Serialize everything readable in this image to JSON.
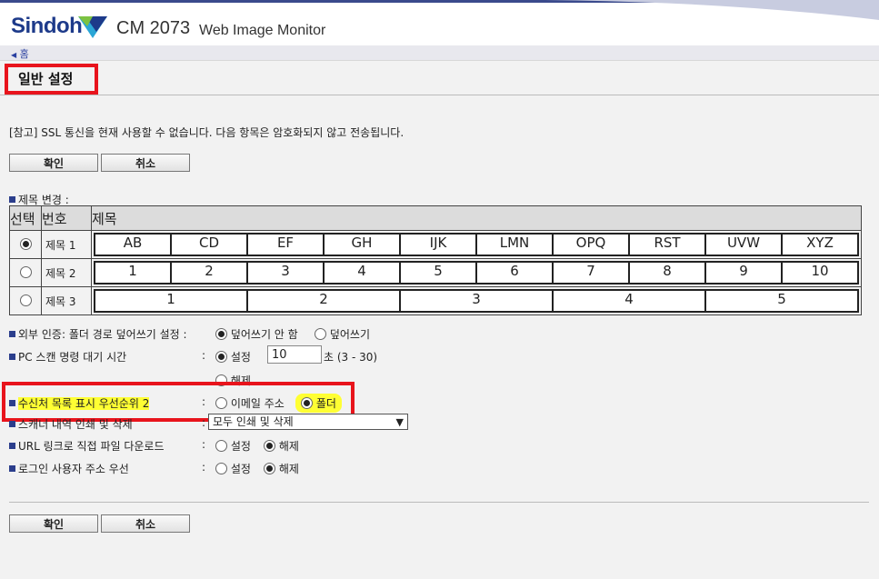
{
  "header": {
    "brand": "Sindoh",
    "model": "CM 2073",
    "product": "Web Image Monitor"
  },
  "nav": {
    "home_label": "홈"
  },
  "page": {
    "title": "일반 설정",
    "note": "[참고] SSL 통신을 현재 사용할 수 없습니다. 다음 항목은 암호화되지 않고 전송됩니다."
  },
  "buttons": {
    "ok": "확인",
    "cancel": "취소"
  },
  "title_change": {
    "label": "제목 변경 :",
    "headers": {
      "select": "선택",
      "number": "번호",
      "title": "제목"
    },
    "rows": [
      {
        "name": "제목 1",
        "selected": true,
        "cells": [
          "AB",
          "CD",
          "EF",
          "GH",
          "IJK",
          "LMN",
          "OPQ",
          "RST",
          "UVW",
          "XYZ"
        ]
      },
      {
        "name": "제목 2",
        "selected": false,
        "cells": [
          "1",
          "2",
          "3",
          "4",
          "5",
          "6",
          "7",
          "8",
          "9",
          "10"
        ]
      },
      {
        "name": "제목 3",
        "selected": false,
        "cells": [
          "1",
          "2",
          "3",
          "4",
          "5"
        ]
      }
    ]
  },
  "settings": {
    "external_auth": {
      "label": "외부 인증: 폴더 경로 덮어쓰기 설정 :",
      "opt1": "덮어쓰기 안 함",
      "opt2": "덮어쓰기",
      "selected": "opt1"
    },
    "pc_scan": {
      "label": "PC 스캔 명령 대기 시간",
      "opt_set": "설정",
      "value": "10",
      "unit_range": "초 (3 - 30)",
      "opt_release": "해제",
      "selected": "opt_set"
    },
    "dest_priority": {
      "label": "수신처 목록 표시 우선순위 2",
      "opt1": "이메일 주소",
      "opt2": "폴더",
      "selected": "opt2"
    },
    "scanner_history": {
      "label": "스캐너 내역 인쇄 및 삭제",
      "value": "모두 인쇄 및 삭제"
    },
    "url_download": {
      "label": "URL 링크로 직접 파일 다운로드",
      "opt1": "설정",
      "opt2": "해제",
      "selected": "opt2"
    },
    "login_user_addr": {
      "label": "로그인 사용자 주소 우선",
      "opt1": "설정",
      "opt2": "해제",
      "selected": "opt2"
    }
  },
  "colors": {
    "accent": "#2b3e8c",
    "highlight_border": "#e8141c",
    "highlight_marker": "#ffff33"
  }
}
